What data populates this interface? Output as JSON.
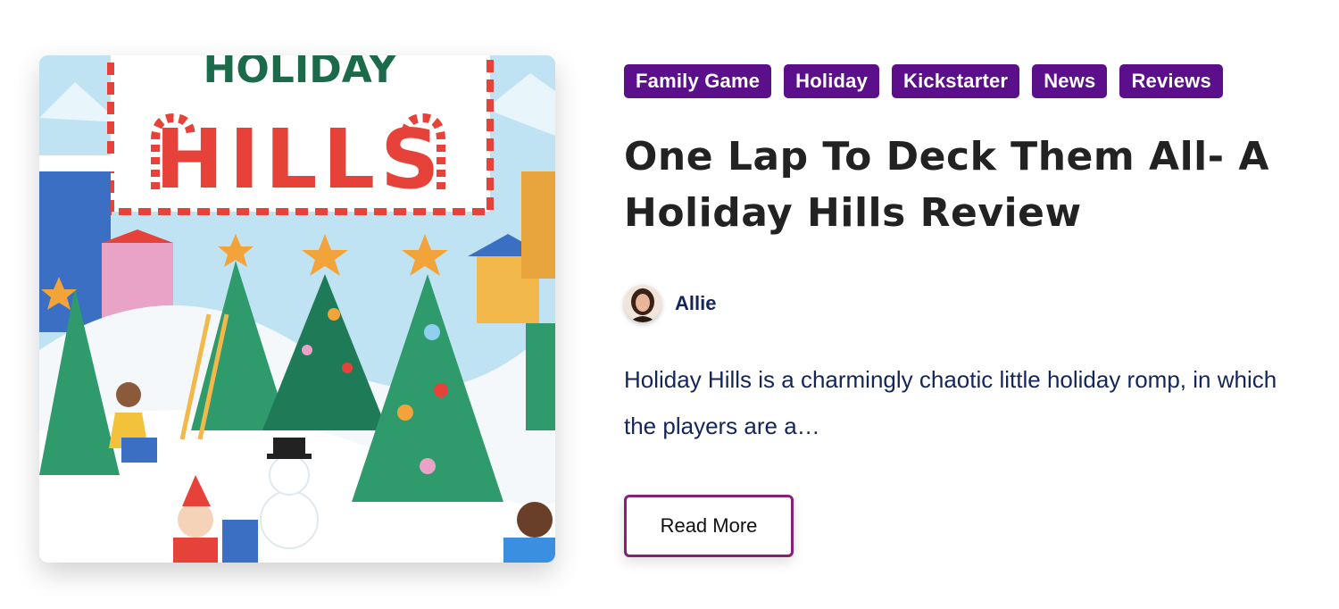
{
  "post": {
    "tags": [
      "Family Game",
      "Holiday",
      "Kickstarter",
      "News",
      "Reviews"
    ],
    "title": "One Lap To Deck Them All- A Holiday Hills Review",
    "author": {
      "name": "Allie"
    },
    "excerpt": "Holiday Hills is a charmingly chaotic little holiday romp, in which the players are a…",
    "read_more_label": "Read More",
    "image": {
      "sign_top_text": "HOLIDAY",
      "sign_main_text": "HILLS"
    }
  },
  "colors": {
    "tag_bg": "#5b0f8a",
    "title_text": "#222222",
    "body_text": "#14255a",
    "button_border": "#8a1f78"
  }
}
